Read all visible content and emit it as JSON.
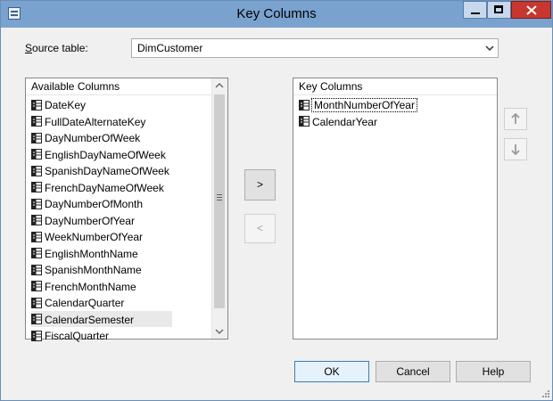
{
  "window": {
    "title": "Key Columns"
  },
  "source": {
    "label_prefix": "S",
    "label_rest": "ource table:",
    "value": "DimCustomer"
  },
  "available": {
    "header": "Available Columns",
    "items": [
      "DateKey",
      "FullDateAlternateKey",
      "DayNumberOfWeek",
      "EnglishDayNameOfWeek",
      "SpanishDayNameOfWeek",
      "FrenchDayNameOfWeek",
      "DayNumberOfMonth",
      "DayNumberOfYear",
      "WeekNumberOfYear",
      "EnglishMonthName",
      "SpanishMonthName",
      "FrenchMonthName",
      "CalendarQuarter",
      "CalendarSemester",
      "FiscalQuarter"
    ],
    "selected_item": "CalendarSemester"
  },
  "key": {
    "header": "Key Columns",
    "items": [
      "MonthNumberOfYear",
      "CalendarYear"
    ],
    "focused_item": "MonthNumberOfYear"
  },
  "buttons": {
    "move_right": ">",
    "move_left": "<",
    "ok": "OK",
    "cancel": "Cancel",
    "help": "Help"
  },
  "icons": {
    "column": "column-icon",
    "move_up": "arrow-up-icon",
    "move_down": "arrow-down-icon"
  },
  "colors": {
    "titlebar": "#79a2cf",
    "close": "#c7372f",
    "selected_row": "#e9e9e9",
    "ok_border": "#3c7fb1"
  }
}
